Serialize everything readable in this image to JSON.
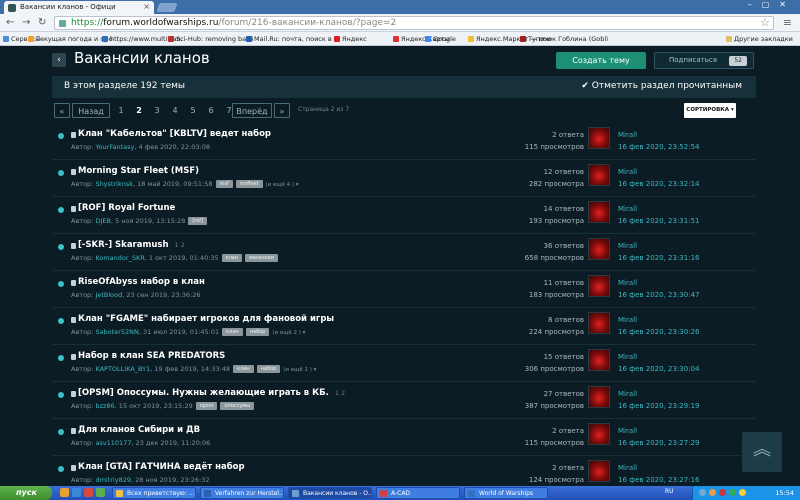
{
  "browser": {
    "tab_title": "Вакансии кланов - Офици",
    "url_scheme": "https://",
    "url_host": "forum.worldofwarships.ru",
    "url_path": "/forum/216-вакансии-кланов/?page=2",
    "bookmarks": [
      {
        "label": "Сервисы",
        "color": "#4a90d9"
      },
      {
        "label": "Текущая погода и про",
        "color": "#f0a030"
      },
      {
        "label": "https://www.multitran.",
        "color": "#2d6fb8"
      },
      {
        "label": "Sci-Hub: removing barri",
        "color": "#c03030"
      },
      {
        "label": "Mail.Ru: почта, поиск в",
        "color": "#1e5fb4"
      },
      {
        "label": "Яндекс",
        "color": "#e02020"
      },
      {
        "label": "Яндекс.Карты",
        "color": "#e03030"
      },
      {
        "label": "Google",
        "color": "#4285f4"
      },
      {
        "label": "Яндекс.Маркет — пои",
        "color": "#f0c030"
      },
      {
        "label": "Тупичок Гоблина (Gobli",
        "color": "#a02020"
      },
      {
        "label": "Другие закладки",
        "color": "#e0c060"
      }
    ]
  },
  "forum": {
    "title": "Вакансии кланов",
    "create_label": "Создать тему",
    "subscribe_label": "Подписаться",
    "subscribe_count": "52",
    "topics_info": "В этом разделе 192 темы",
    "mark_read_label": "Отметить раздел прочитанным"
  },
  "pager": {
    "first": "«",
    "prev": "Назад",
    "pages": [
      "1",
      "2",
      "3",
      "4",
      "5",
      "6",
      "7"
    ],
    "next": "Вперёд",
    "last": "»",
    "info": "Страница 2 из 7",
    "sort_label": "СОРТИРОВКА"
  },
  "topics": [
    {
      "title": "Клан \"Кабельтов\" [KBLTV] ведет набор",
      "pages": "",
      "author_prefix": "Автор:",
      "author": "YourFantasy",
      "date": ", 4 фев 2020, 22:03:08",
      "tags": [],
      "more": "",
      "replies": "2 ответа",
      "views": "115 просмотров",
      "last_user": "Mirall",
      "last_date": "16 фев 2020, 23:52:54"
    },
    {
      "title": "Morning Star Fleet (MSF)",
      "pages": "",
      "author_prefix": "Автор:",
      "author": "Shystriknsk",
      "date": ", 18 май 2019, 09:51:58",
      "tags": [
        "msf",
        "msfleet"
      ],
      "more": "(и ещё 4 ) ▾",
      "replies": "12 ответов",
      "views": "282 просмотра",
      "last_user": "Mirall",
      "last_date": "16 фев 2020, 23:32:14"
    },
    {
      "title": "[ROF] Royal Fortune",
      "pages": "",
      "author_prefix": "Автор:",
      "author": "DJEB",
      "date": ", 5 ноя 2019, 13:15:28",
      "tags": [
        "[rof]"
      ],
      "more": "",
      "replies": "14 ответов",
      "views": "193 просмотра",
      "last_user": "Mirall",
      "last_date": "16 фев 2020, 23:31:51"
    },
    {
      "title": "[-SKR-] Skaramush",
      "pages": "1   2",
      "author_prefix": "Автор:",
      "author": "Komandor_SKR",
      "date": ", 1 окт 2019, 01:40:35",
      "tags": [
        "клан",
        "вакансии"
      ],
      "more": "",
      "replies": "36 ответов",
      "views": "658 просмотров",
      "last_user": "Mirall",
      "last_date": "16 фев 2020, 23:31:16"
    },
    {
      "title": "RiseOfAbyss набор в клан",
      "pages": "",
      "author_prefix": "Автор:",
      "author": "JetBlood",
      "date": ", 23 сен 2019, 23:36:26",
      "tags": [],
      "more": "",
      "replies": "11 ответов",
      "views": "183 просмотра",
      "last_user": "Mirall",
      "last_date": "16 фев 2020, 23:30:47"
    },
    {
      "title": "Клан \"FGAME\" набирает игроков для фановой игры",
      "pages": "",
      "author_prefix": "Автор:",
      "author": "Saboter52NN",
      "date": ", 31 июл 2019, 01:45:01",
      "tags": [
        "клан",
        "набор"
      ],
      "more": "(и ещё 2 ) ▾",
      "replies": "8 ответов",
      "views": "224 просмотра",
      "last_user": "Mirall",
      "last_date": "16 фев 2020, 23:30:26"
    },
    {
      "title": "Набор в клан SEA PREDATORS",
      "pages": "",
      "author_prefix": "Автор:",
      "author": "KAPTOLLIKA_BY1",
      "date": ", 19 фев 2019, 14:33:48",
      "tags": [
        "клан",
        "набор"
      ],
      "more": "(и ещё 1 ) ▾",
      "replies": "15 ответов",
      "views": "306 просмотров",
      "last_user": "Mirall",
      "last_date": "16 фев 2020, 23:30:04"
    },
    {
      "title": "[OPSM] Опоссумы. Нужны желающие играть в КБ.",
      "pages": "1   2",
      "author_prefix": "Автор:",
      "author": "bzz86",
      "date": ", 15 окт 2019, 23:15:29",
      "tags": [
        "opsm",
        "опоссумы"
      ],
      "more": "",
      "replies": "27 ответов",
      "views": "387 просмотров",
      "last_user": "Mirall",
      "last_date": "16 фев 2020, 23:29:19"
    },
    {
      "title": "Для кланов Сибири и ДВ",
      "pages": "",
      "author_prefix": "Автор:",
      "author": "asv110177",
      "date": ", 23 дек 2019, 11:20:06",
      "tags": [],
      "more": "",
      "replies": "2 ответа",
      "views": "115 просмотров",
      "last_user": "Mirall",
      "last_date": "16 фев 2020, 23:27:29"
    },
    {
      "title": "Клан [GTA] ГАТЧИНА ведёт набор",
      "pages": "",
      "author_prefix": "Автор:",
      "author": "dmitriy829",
      "date": ", 28 ноя 2019, 23:26:32",
      "tags": [],
      "more": "",
      "replies": "2 ответа",
      "views": "124 просмотра",
      "last_user": "Mirall",
      "last_date": "16 фев 2020, 23:27:16"
    }
  ],
  "taskbar": {
    "start_label": "пуск",
    "tasks": [
      {
        "label": "Всех приветствую: ...",
        "color": "#f0c040"
      },
      {
        "label": "Verfahren zur Herstel...",
        "color": "#2b5fb0"
      },
      {
        "label": "Вакансии кланов - О...",
        "color": "#6aa0d0"
      },
      {
        "label": "A-CAD",
        "color": "#d04040"
      },
      {
        "label": "World of Warships",
        "color": "#3070c0"
      }
    ],
    "lang": "RU",
    "clock": "15:54"
  }
}
